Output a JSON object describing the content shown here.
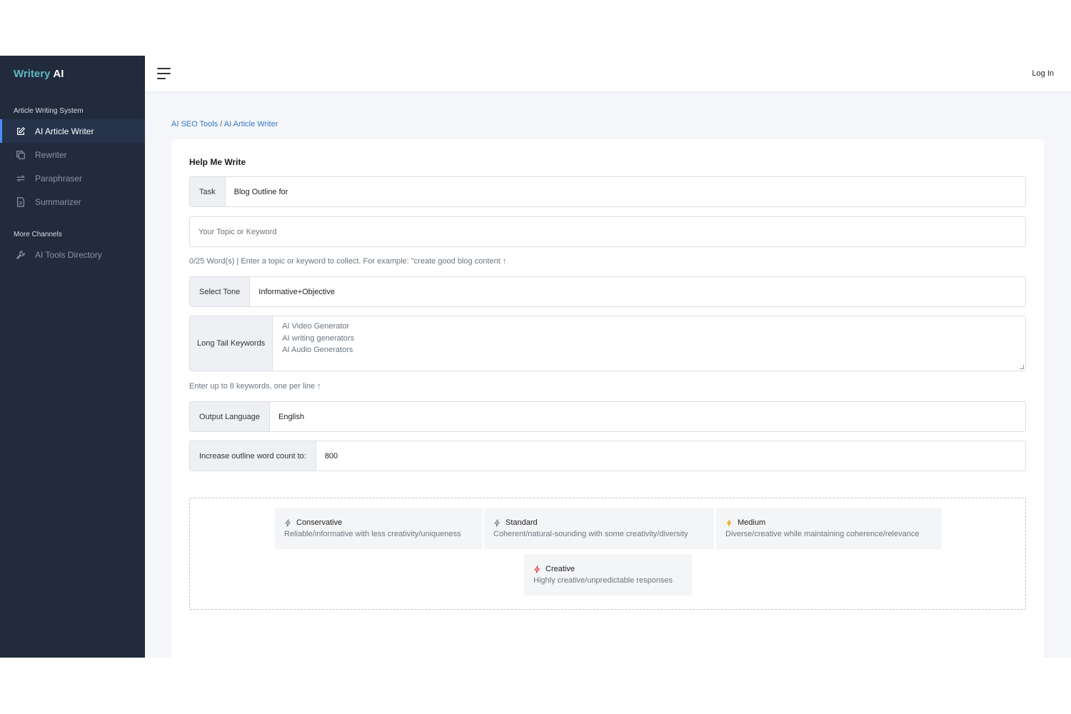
{
  "brand": {
    "part1": "Writery",
    "part2": "AI"
  },
  "sidebar": {
    "section1": "Article Writing System",
    "items": [
      {
        "label": "AI Article Writer",
        "icon": "edit-icon",
        "active": true
      },
      {
        "label": "Rewriter",
        "icon": "copy-icon"
      },
      {
        "label": "Paraphraser",
        "icon": "repeat-icon"
      },
      {
        "label": "Summarizer",
        "icon": "file-icon"
      }
    ],
    "section2": "More Channels",
    "items2": [
      {
        "label": "AI Tools Directory",
        "icon": "wrench-icon"
      }
    ]
  },
  "header": {
    "login": "Log In"
  },
  "breadcrumb": {
    "root": "AI SEO Tools",
    "sep": "/",
    "current": "AI Article Writer"
  },
  "form": {
    "title": "Help Me Write",
    "task_label": "Task",
    "task_value": "Blog Outline for",
    "topic_placeholder": "Your Topic or Keyword",
    "topic_help": "0/25 Word(s) | Enter a topic or keyword to collect. For example: \"create good blog content ↑",
    "tone_label": "Select Tone",
    "tone_value": "Informative+Objective",
    "keywords_label": "Long Tail Keywords",
    "keywords_placeholder": [
      "AI Video Generator",
      "AI writing generators",
      "AI Audio Generators"
    ],
    "keywords_help": "Enter up to 8 keywords, one per line ↑",
    "language_label": "Output Language",
    "language_value": "English",
    "wordcount_label": "Increase outline word count to:",
    "wordcount_value": "800"
  },
  "modes": [
    {
      "title": "Conservative",
      "desc": "Reliable/informative with less creativity/uniqueness",
      "color": "#6c757d"
    },
    {
      "title": "Standard",
      "desc": "Coherent/natural-sounding with some creativity/diversity",
      "color": "#6c757d"
    },
    {
      "title": "Medium",
      "desc": "Diverse/creative while maintaining coherence/relevance",
      "color": "#f0a830"
    },
    {
      "title": "Creative",
      "desc": "Highly creative/unpredictable responses",
      "color": "#e0403c"
    }
  ],
  "colors": {
    "sidebar_bg": "#212b3b",
    "accent": "#4c8df6",
    "link": "#2f78c4",
    "brand_teal": "#5fb6c4"
  }
}
